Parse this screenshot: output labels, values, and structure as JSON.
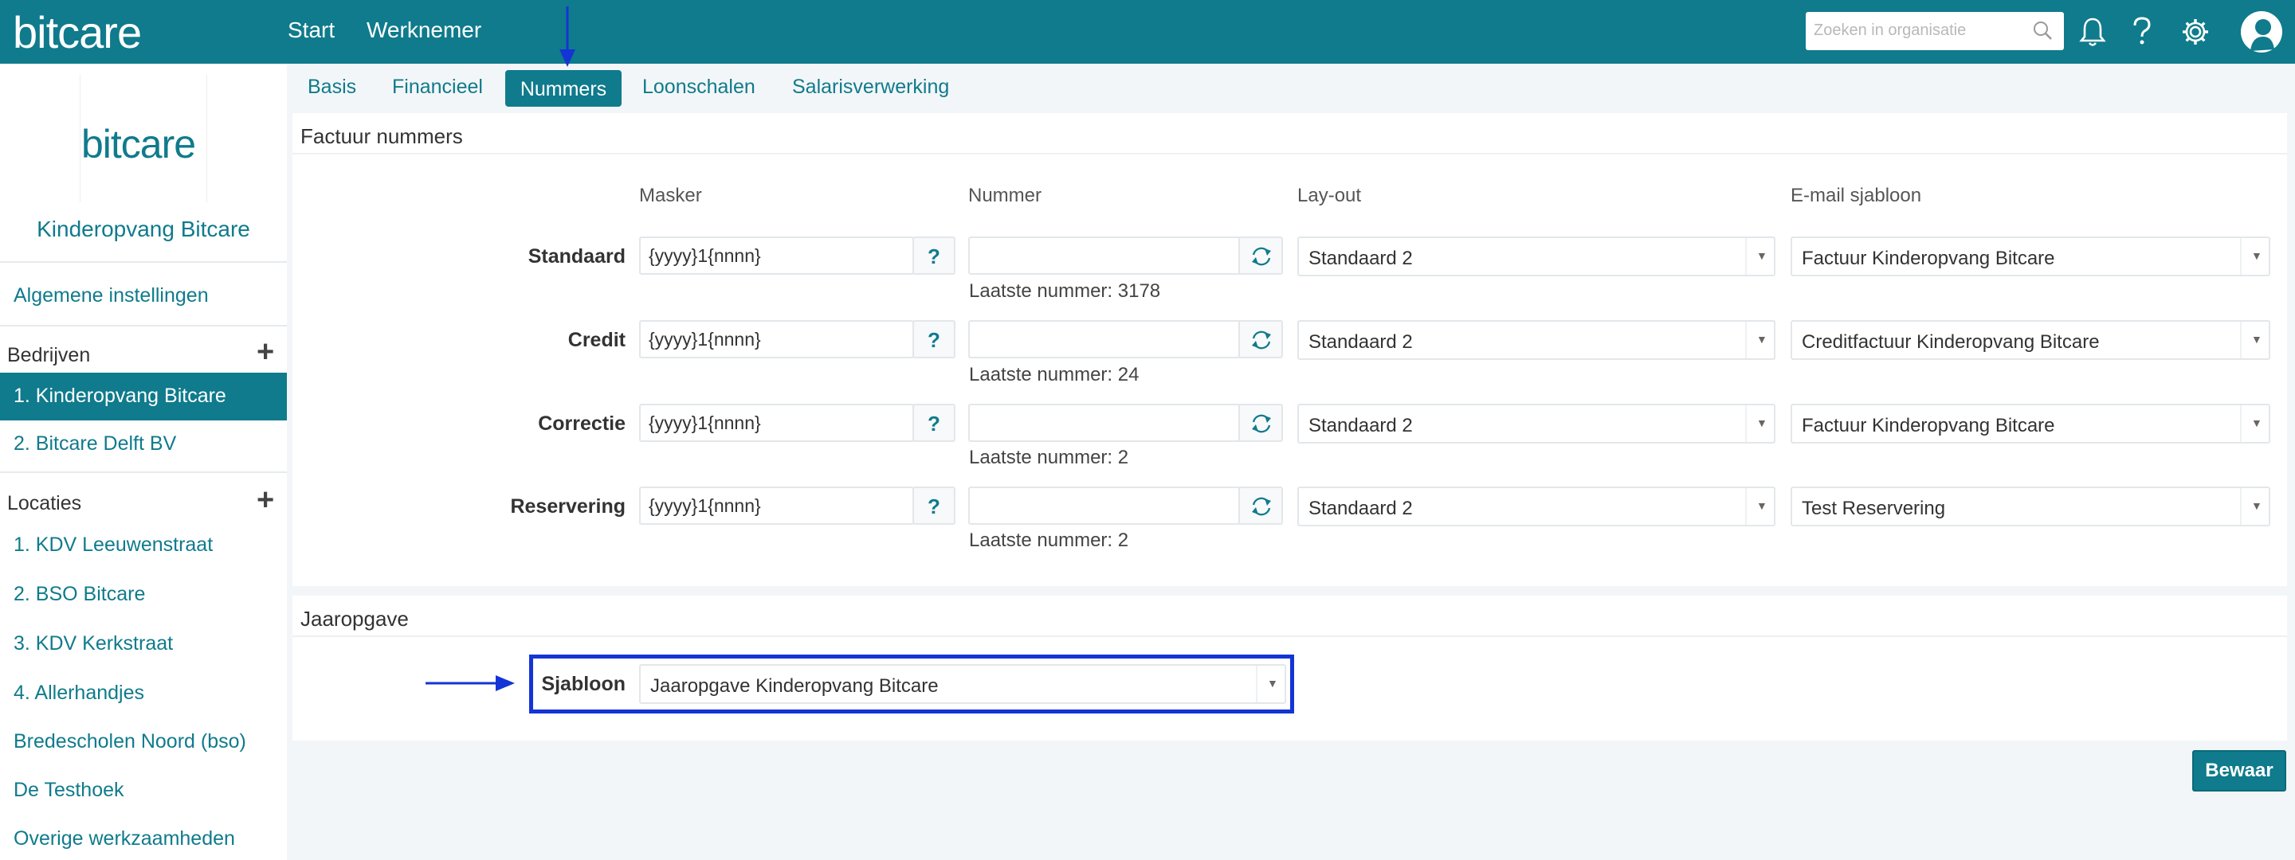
{
  "app": {
    "logo": "bitcare"
  },
  "topnav": {
    "start": "Start",
    "werknemer": "Werknemer"
  },
  "search": {
    "placeholder": "Zoeken in organisatie"
  },
  "sidebar": {
    "logo": "bitcare",
    "org_name": "Kinderopvang Bitcare",
    "general": "Algemene instellingen",
    "companies_heading": "Bedrijven",
    "companies": [
      "1. Kinderopvang Bitcare",
      "2. Bitcare Delft BV"
    ],
    "locations_heading": "Locaties",
    "locations": [
      "1. KDV Leeuwenstraat",
      "2. BSO Bitcare",
      "3. KDV Kerkstraat",
      "4. Allerhandjes",
      "Bredescholen Noord (bso)",
      "De Testhoek",
      "Overige werkzaamheden"
    ]
  },
  "tabs": [
    "Basis",
    "Financieel",
    "Nummers",
    "Loonschalen",
    "Salarisverwerking"
  ],
  "active_tab": "Nummers",
  "invoice": {
    "title": "Factuur nummers",
    "columns": {
      "mask": "Masker",
      "number": "Nummer",
      "layout": "Lay-out",
      "email": "E-mail sjabloon"
    },
    "help_label": "?",
    "rows": [
      {
        "label": "Standaard",
        "mask": "{yyyy}1{nnnn}",
        "number": "",
        "last": "Laatste nummer: 3178",
        "layout": "Standaard 2",
        "email": "Factuur Kinderopvang Bitcare"
      },
      {
        "label": "Credit",
        "mask": "{yyyy}1{nnnn}",
        "number": "",
        "last": "Laatste nummer: 24",
        "layout": "Standaard 2",
        "email": "Creditfactuur Kinderopvang Bitcare"
      },
      {
        "label": "Correctie",
        "mask": "{yyyy}1{nnnn}",
        "number": "",
        "last": "Laatste nummer: 2",
        "layout": "Standaard 2",
        "email": "Factuur Kinderopvang Bitcare"
      },
      {
        "label": "Reservering",
        "mask": "{yyyy}1{nnnn}",
        "number": "",
        "last": "Laatste nummer: 2",
        "layout": "Standaard 2",
        "email": "Test Reservering"
      }
    ]
  },
  "annual": {
    "title": "Jaaropgave",
    "template_label": "Sjabloon",
    "template_value": "Jaaropgave Kinderopvang Bitcare"
  },
  "save_label": "Bewaar",
  "colors": {
    "brand": "#0f7b8c",
    "annotation": "#1434d6"
  }
}
